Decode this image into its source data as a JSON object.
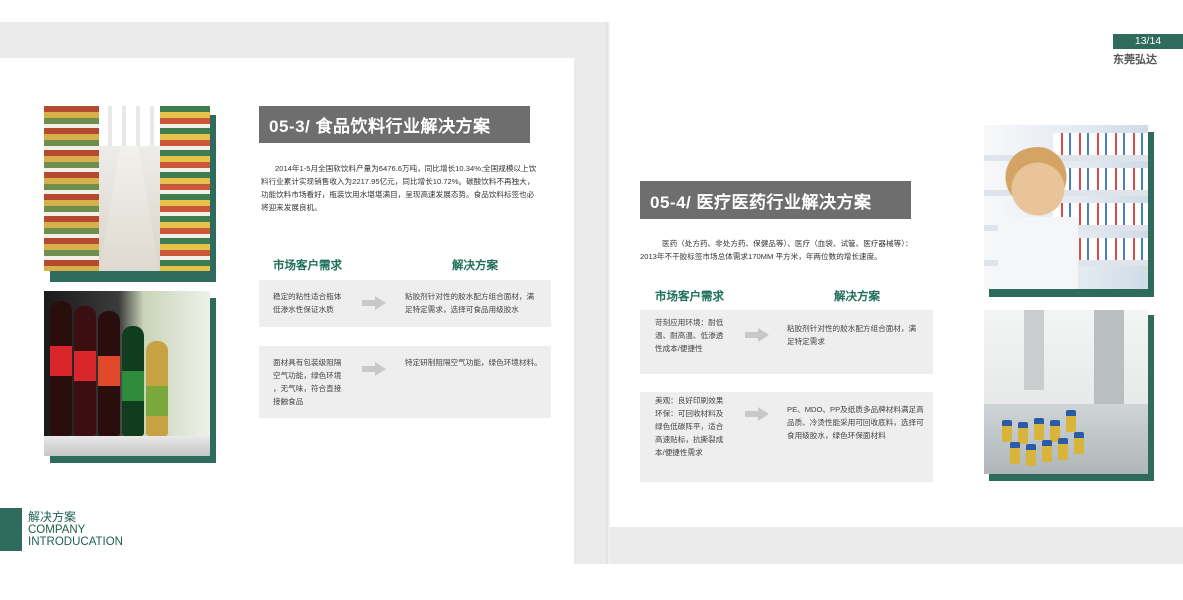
{
  "page_number": "13/14",
  "brand": "东莞弘达",
  "footer": {
    "cn": "解决方案",
    "en_line1": "COMPANY",
    "en_line2": "INTRODUCATION"
  },
  "left_section": {
    "title": "05-3/ 食品饮料行业解决方案",
    "paragraph_lines": [
      "2014年1-5月全国软饮料产量为6476.6万吨，同比增长10.34%;全国规模以上饮",
      "料行业累计实现销售收入为2217.95亿元，同比增长10.72%。碳酸饮料不再独大，",
      "功能饮料市场看好，瓶装饮用水堪堪满目，呈现高速发展态势。食品饮料标签也必",
      "将迎来发展良机。"
    ],
    "col_need": "市场客户需求",
    "col_solution": "解决方案",
    "rows": [
      {
        "need_lines": [
          "稳定的粘性适合瓶体",
          "低渗水性保证水质"
        ],
        "solution_lines": [
          "粘胶剂针对性的胶水配方组合面材，满",
          "足特定需求，选择可食品用级胶水"
        ]
      },
      {
        "need_lines": [
          "面材具有包装级阻隔",
          "空气功能，绿色环境",
          "，无气味，符合直接",
          "接触食品"
        ],
        "solution_lines": [
          "特定研制阻隔空气功能，绿色环境材料。"
        ]
      }
    ]
  },
  "right_section": {
    "title": "05-4/ 医疗医药行业解决方案",
    "paragraph_lines": [
      "医药（处方药、非处方药、保健品等）、医疗（血袋、试管、医疗器械等）：",
      "2013年不干胶标签市场总体需求170MM 平方米，年两位数的增长速度。"
    ],
    "col_need": "市场客户需求",
    "col_solution": "解决方案",
    "rows": [
      {
        "need_lines": [
          "苛刻应用环境：耐低",
          "温、耐高温、低渗透",
          "性成本/便捷性"
        ],
        "solution_lines": [
          "粘胶剂针对性的胶水配方组合面材，满",
          "足特定需求"
        ]
      },
      {
        "need_lines": [
          "美观：良好印刷效果",
          "环保：可回收材料及",
          "绿色低碳阵平，适合",
          "高速贴标，抗撕裂成",
          "本/便捷性需求"
        ],
        "solution_lines": [
          "PE、MDO、PP及纸质多品牌材料满足高",
          "品质、冷烫性能采用可回收底料，选择可",
          "食用级胶水，绿色环保面材料"
        ]
      }
    ]
  },
  "icons": {
    "arrow": "right-arrow-icon"
  },
  "colors": {
    "accent": "#2e6b5c",
    "title_box": "#6e6e6e",
    "row_bg": "#eeeeee",
    "heading": "#1f6f5a"
  }
}
